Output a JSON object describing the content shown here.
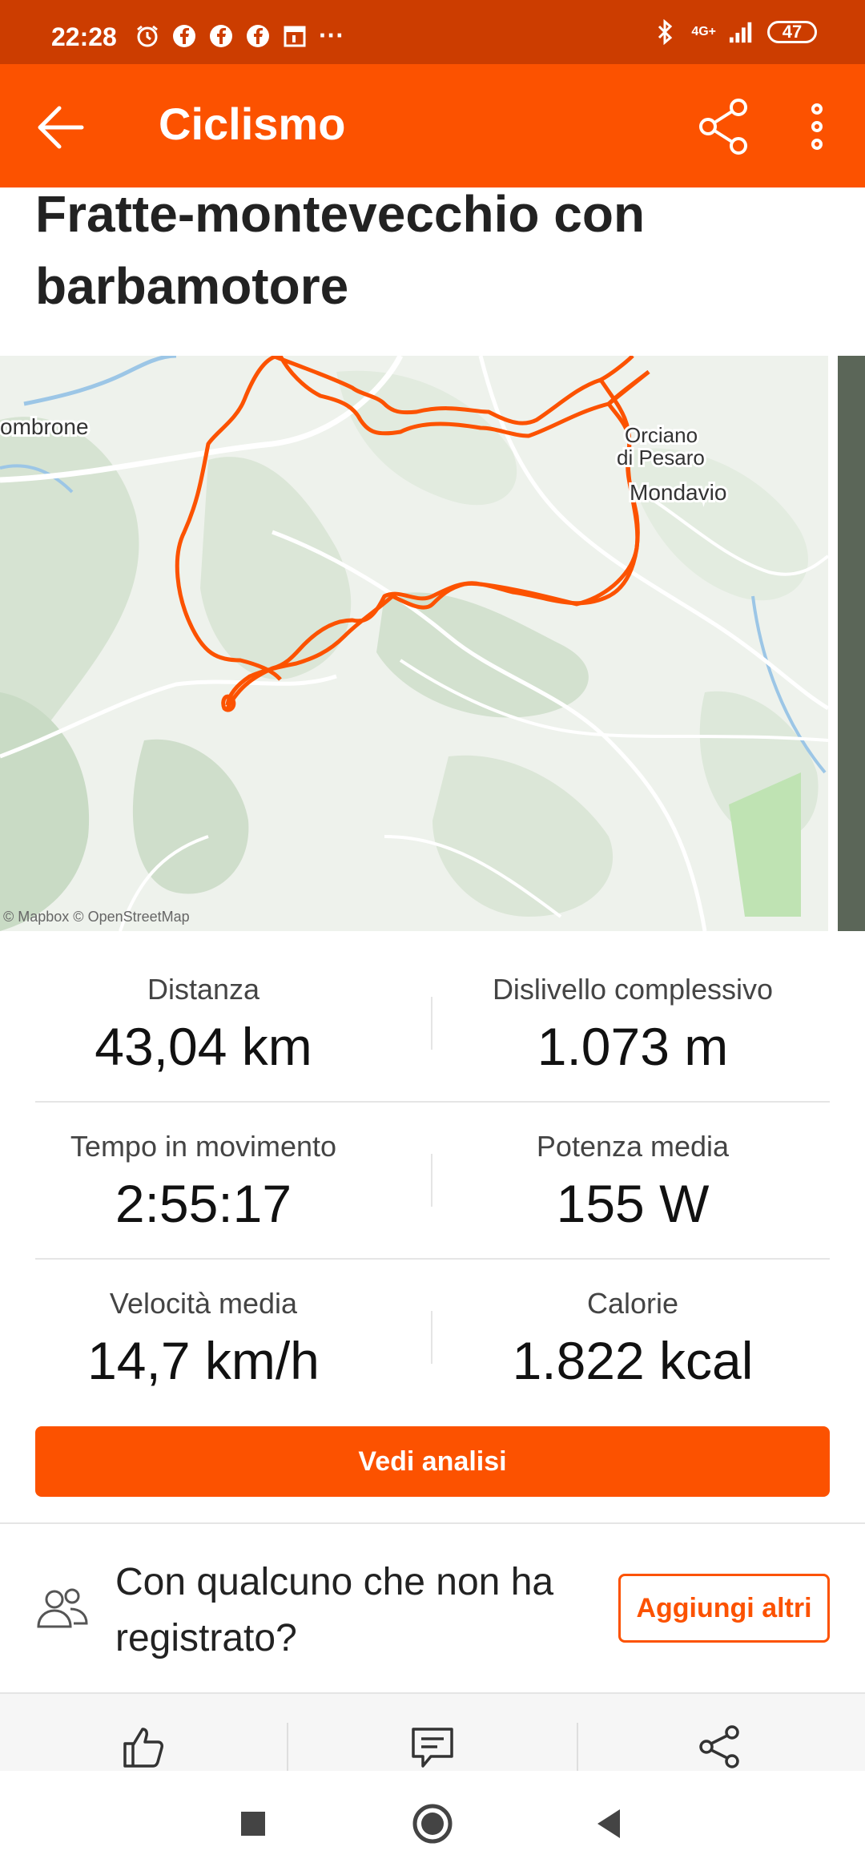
{
  "status_bar": {
    "time": "22:28",
    "more": "···",
    "network": "4G+",
    "battery": "47"
  },
  "app_bar": {
    "title": "Ciclismo"
  },
  "activity": {
    "title": "Fratte-montevecchio con barbamotore"
  },
  "map": {
    "labels": [
      "ombrone",
      "Orciano",
      "di Pesaro",
      "Mondavio"
    ],
    "attribution": "© Mapbox © OpenStreetMap",
    "route_color": "#fc5200"
  },
  "stats": [
    {
      "label": "Distanza",
      "value": "43,04 km"
    },
    {
      "label": "Dislivello complessivo",
      "value": "1.073 m"
    },
    {
      "label": "Tempo in movimento",
      "value": "2:55:17"
    },
    {
      "label": "Potenza media",
      "value": "155 W"
    },
    {
      "label": "Velocità media",
      "value": "14,7 km/h"
    },
    {
      "label": "Calorie",
      "value": "1.822 kcal"
    }
  ],
  "cta": {
    "label": "Vedi analisi"
  },
  "together": {
    "text": "Con qualcuno che non ha registrato?",
    "button": "Aggiungi altri"
  },
  "action_icons": [
    "thumbs-up-icon",
    "comment-icon",
    "share-icon"
  ],
  "nav_icons": [
    "recents-square-icon",
    "home-circle-icon",
    "back-triangle-icon"
  ],
  "colors": {
    "accent": "#fc5200",
    "status_bar": "#cc3d00"
  }
}
